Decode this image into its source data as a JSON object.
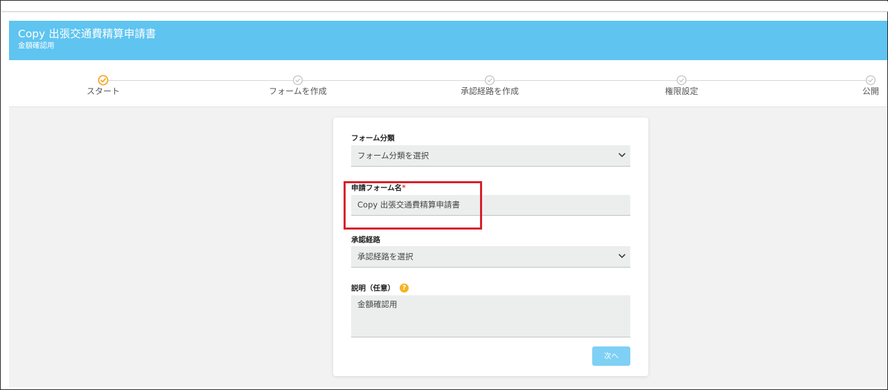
{
  "header": {
    "title": "Copy 出張交通費精算申請書",
    "subtitle": "金額確認用"
  },
  "stepper": {
    "steps": [
      {
        "label": "スタート",
        "state": "current"
      },
      {
        "label": "フォームを作成",
        "state": "pending"
      },
      {
        "label": "承認経路を作成",
        "state": "pending"
      },
      {
        "label": "権限設定",
        "state": "pending"
      },
      {
        "label": "公開",
        "state": "pending"
      }
    ]
  },
  "form": {
    "category": {
      "label": "フォーム分類",
      "value": "フォーム分類を選択"
    },
    "form_name": {
      "label": "申請フォーム名",
      "required_mark": "*",
      "value": "Copy 出張交通費精算申請書"
    },
    "approval_route": {
      "label": "承認経路",
      "value": "承認経路を選択"
    },
    "description": {
      "label": "説明（任意）",
      "help_glyph": "?",
      "value": "金額確認用"
    },
    "next_label": "次へ"
  },
  "colors": {
    "header_bg": "#5fc4f0",
    "step_active": "#f5a623",
    "step_inactive": "#c7c7c7",
    "highlight_border": "#d7202a",
    "button_bg": "#7fd0f5",
    "required": "#e0403e",
    "help_icon": "#f5b321"
  }
}
